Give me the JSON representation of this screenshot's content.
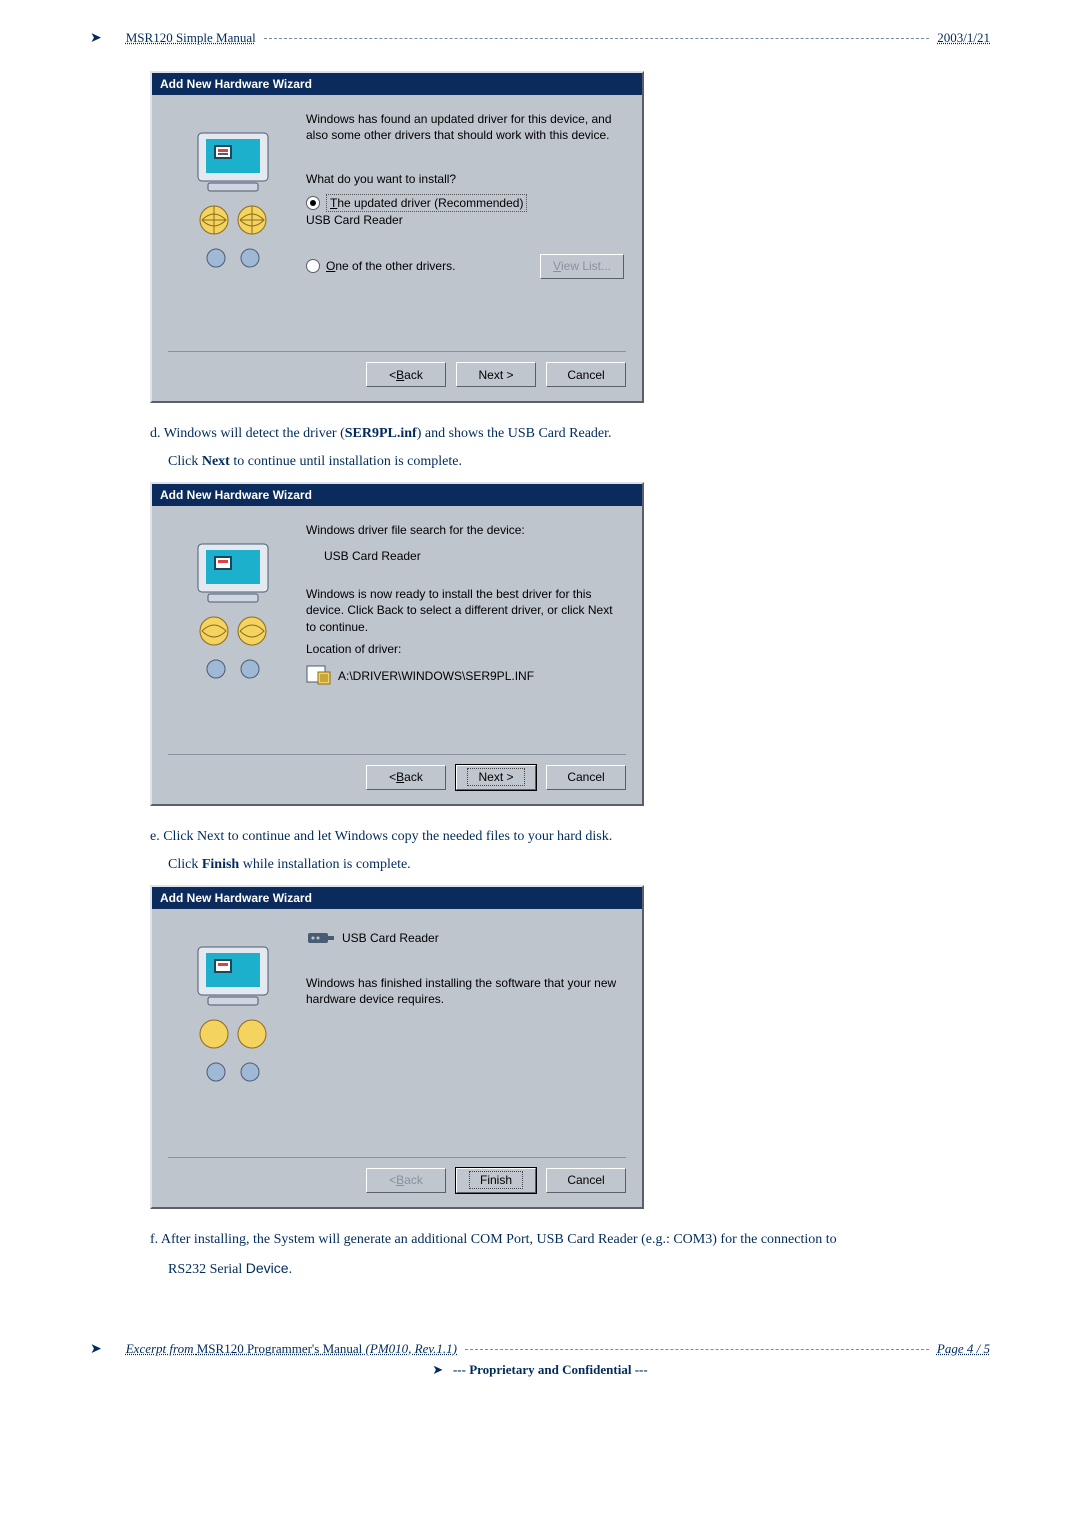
{
  "header": {
    "title": "MSR120 Simple Manual",
    "date": "2003/1/21"
  },
  "dialog1": {
    "title": "Add New Hardware Wizard",
    "intro": "Windows has found an updated driver for this device, and also some other drivers that should work with this device.",
    "question": "What do you want to install?",
    "option_recommended_prefix_letter": "T",
    "option_recommended_rest": "he updated driver (Recommended)",
    "device_name": "USB Card Reader",
    "option_other_prefix_letter": "O",
    "option_other_rest": "ne of the other drivers.",
    "view_list": "View List...",
    "back": "< Back",
    "back_ul": "B",
    "next": "Next >",
    "cancel": "Cancel"
  },
  "step_d": {
    "line1_pre": "d. Windows will detect the driver (",
    "line1_bold": "SER9PL.inf",
    "line1_post": ") and shows the USB Card Reader.",
    "line2_pre": "Click ",
    "line2_bold": "Next",
    "line2_post": " to continue until installation is complete."
  },
  "dialog2": {
    "title": "Add New Hardware Wizard",
    "intro": "Windows driver file search for the device:",
    "device_name": "USB Card Reader",
    "ready": "Windows is now ready to install the best driver for this device. Click Back to select a different driver, or click Next to continue.",
    "location_label": "Location of driver:",
    "path": "A:\\DRIVER\\WINDOWS\\SER9PL.INF",
    "back": "< Back",
    "next": "Next >",
    "cancel": "Cancel"
  },
  "step_e": {
    "line1": "e. Click Next to continue and let Windows copy the needed files to your hard disk.",
    "line2_pre": "Click ",
    "line2_bold": "Finish",
    "line2_post": " while installation is complete."
  },
  "dialog3": {
    "title": "Add New Hardware Wizard",
    "device_name": "USB Card Reader",
    "finished": "Windows has finished installing the software that your new hardware device requires.",
    "back": "< Back",
    "finish": "Finish",
    "cancel": "Cancel"
  },
  "step_f": {
    "text": "f. After installing, the System will generate an additional COM Port, USB Card Reader (e.g.: COM3) for the connection to RS232 Serial Device."
  },
  "footer": {
    "excerpt_prefix": "Excerpt from ",
    "manual": "MSR120 Programmer's Manual",
    "revision": " (PM010, Rev.1.1)",
    "page": "Page 4 / 5",
    "confidential": "--- Proprietary and Confidential ---"
  }
}
